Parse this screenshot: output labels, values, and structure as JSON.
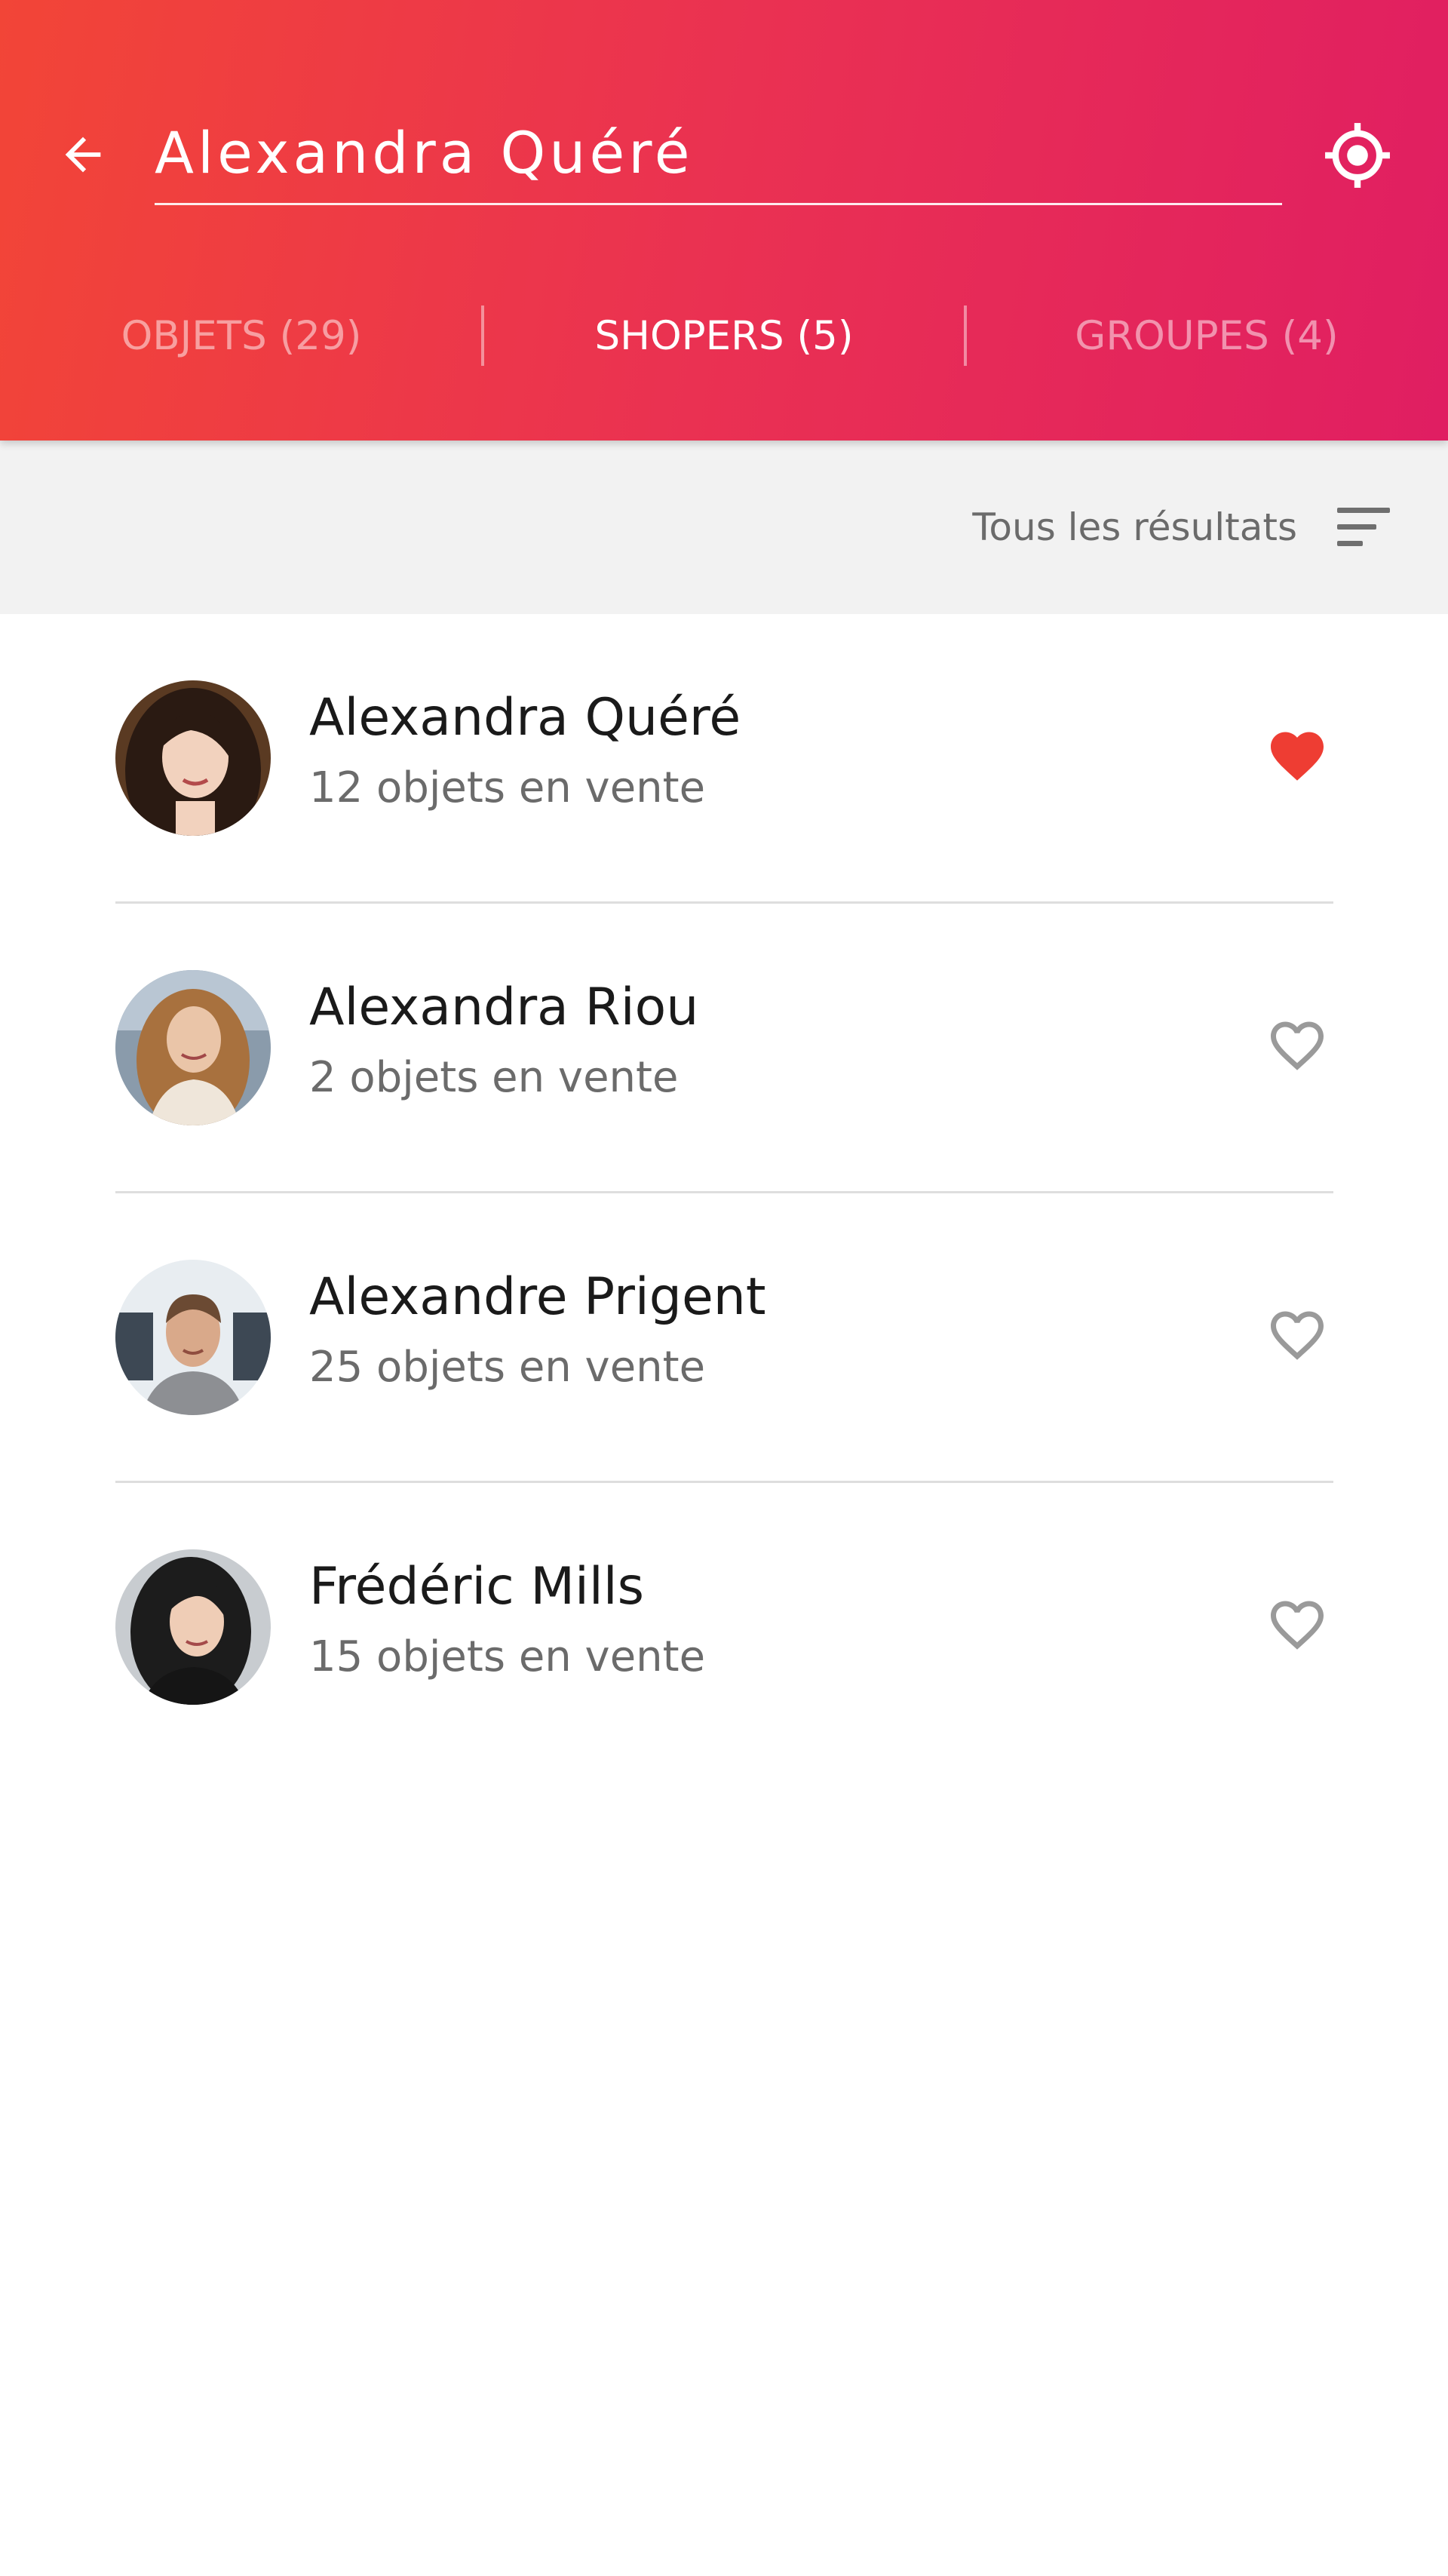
{
  "search": {
    "value": "Alexandra Quéré",
    "back_icon": "arrow-left-icon",
    "location_icon": "crosshair-location-icon"
  },
  "tabs": [
    {
      "label": "OBJETS (29)",
      "active": false
    },
    {
      "label": "SHOPERS (5)",
      "active": true
    },
    {
      "label": "GROUPES (4)",
      "active": false
    }
  ],
  "filter": {
    "label": "Tous les résultats",
    "icon": "sort-lines-icon"
  },
  "shopers": [
    {
      "name": "Alexandra Quéré",
      "count": "12 objets en vente",
      "favorite": true
    },
    {
      "name": "Alexandra Riou",
      "count": "2 objets en vente",
      "favorite": false
    },
    {
      "name": "Alexandre Prigent",
      "count": "25 objets en vente",
      "favorite": false
    },
    {
      "name": "Frédéric Mills",
      "count": "15 objets en vente",
      "favorite": false
    }
  ],
  "colors": {
    "header_start": "#f24537",
    "header_end": "#e01e62",
    "favorite_active": "#ee3d33",
    "favorite_inactive": "#9a9a9a"
  }
}
